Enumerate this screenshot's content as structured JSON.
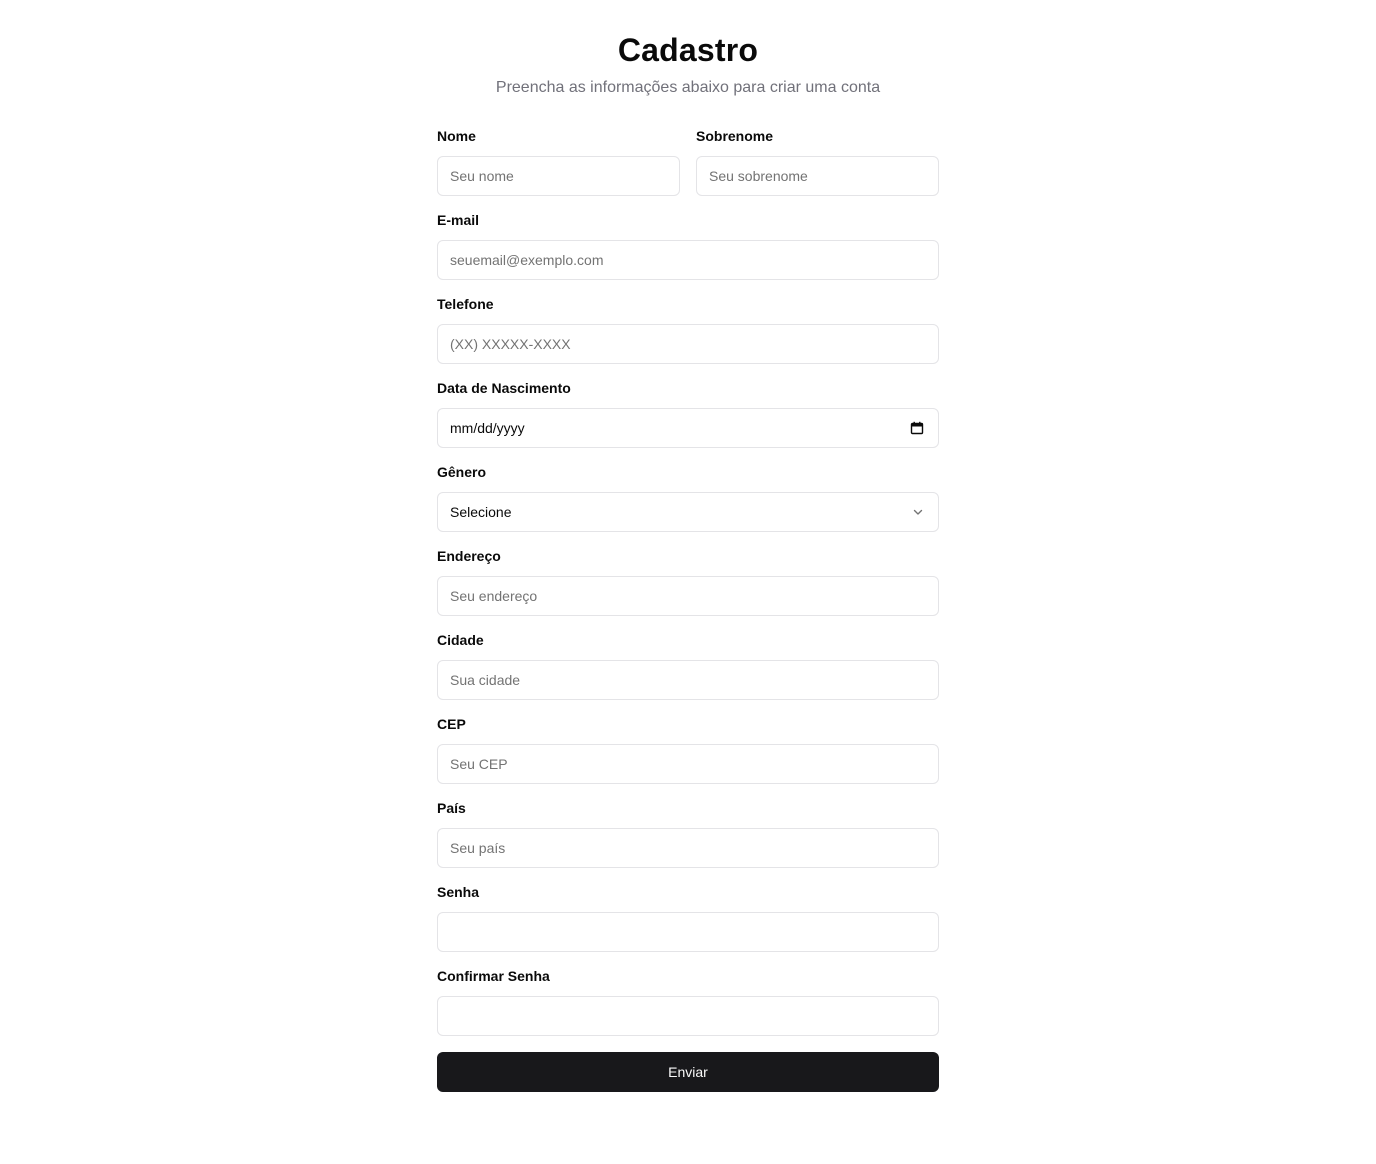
{
  "header": {
    "title": "Cadastro",
    "subtitle": "Preencha as informações abaixo para criar uma conta"
  },
  "form": {
    "first_name": {
      "label": "Nome",
      "placeholder": "Seu nome",
      "value": ""
    },
    "last_name": {
      "label": "Sobrenome",
      "placeholder": "Seu sobrenome",
      "value": ""
    },
    "email": {
      "label": "E-mail",
      "placeholder": "seuemail@exemplo.com",
      "value": ""
    },
    "phone": {
      "label": "Telefone",
      "placeholder": "(XX) XXXXX-XXXX",
      "value": ""
    },
    "birth_date": {
      "label": "Data de Nascimento",
      "value": "mm/dd/yyyy",
      "icon": "calendar-icon"
    },
    "gender": {
      "label": "Gênero",
      "selected": "Selecione",
      "icon": "chevron-down-icon"
    },
    "address": {
      "label": "Endereço",
      "placeholder": "Seu endereço",
      "value": ""
    },
    "city": {
      "label": "Cidade",
      "placeholder": "Sua cidade",
      "value": ""
    },
    "zip": {
      "label": "CEP",
      "placeholder": "Seu CEP",
      "value": ""
    },
    "country": {
      "label": "País",
      "placeholder": "Seu país",
      "value": ""
    },
    "password": {
      "label": "Senha",
      "value": ""
    },
    "confirm_password": {
      "label": "Confirmar Senha",
      "value": ""
    },
    "submit_label": "Enviar"
  },
  "colors": {
    "primary": "#18181b",
    "primary_text": "#fafafa",
    "border": "#e4e4e7",
    "muted_text": "#71717a",
    "placeholder": "#737373"
  }
}
